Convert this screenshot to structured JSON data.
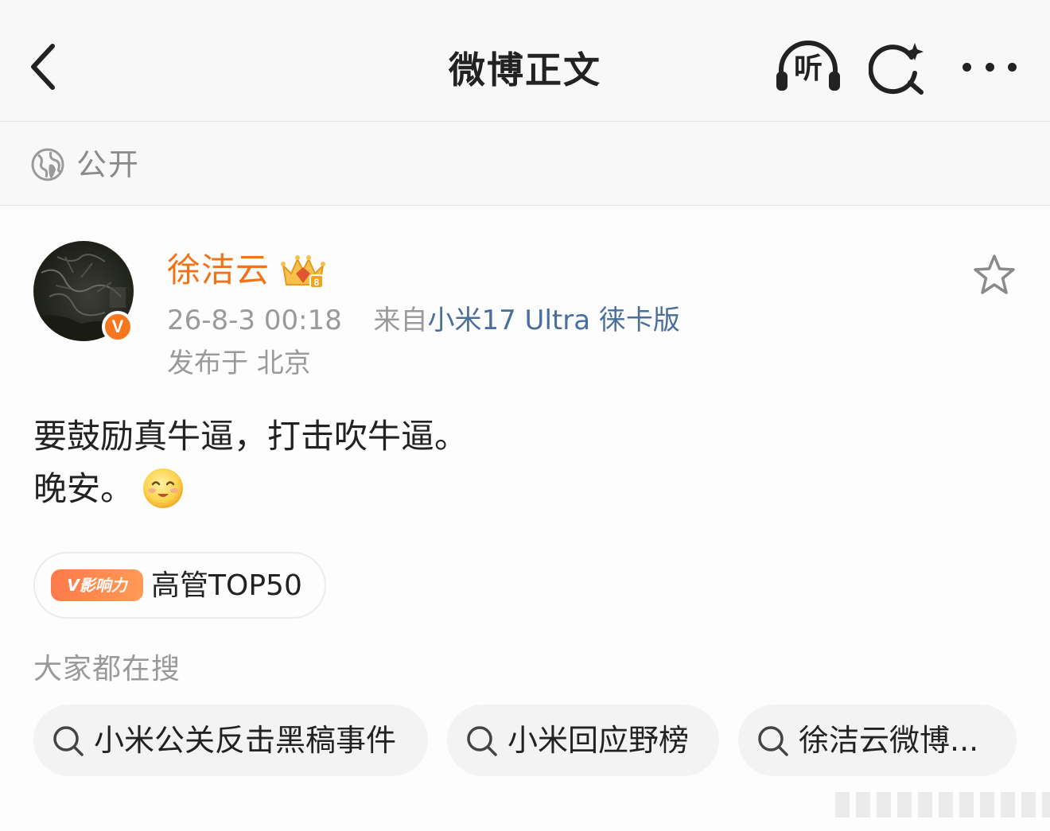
{
  "nav": {
    "title": "微博正文",
    "listen_label": "听"
  },
  "visibility": {
    "label": "公开"
  },
  "post": {
    "author": "徐洁云",
    "time": "26-8-3 00:18",
    "from_prefix": "来自",
    "source": "小米17 Ultra 徕卡版",
    "location": "发布于 北京",
    "lines": [
      "要鼓励真牛逼，打击吹牛逼。",
      "晚安。"
    ],
    "verified_badge": "V"
  },
  "influence_tag": {
    "badge": "V影响力",
    "label": "高管TOP50"
  },
  "trending": {
    "title": "大家都在搜",
    "items": [
      "小米公关反击黑稿事件",
      "小米回应野榜",
      "徐洁云微博..."
    ]
  },
  "colors": {
    "accent_orange": "#f0731a",
    "link_blue": "#4a6f9c",
    "text_gray": "#9a9a9a"
  },
  "icons": [
    "back-arrow-icon",
    "headphones-icon",
    "search-sparkle-icon",
    "more-icon",
    "globe-icon",
    "crown-icon",
    "star-icon",
    "smile-emoji-icon",
    "search-icon"
  ]
}
